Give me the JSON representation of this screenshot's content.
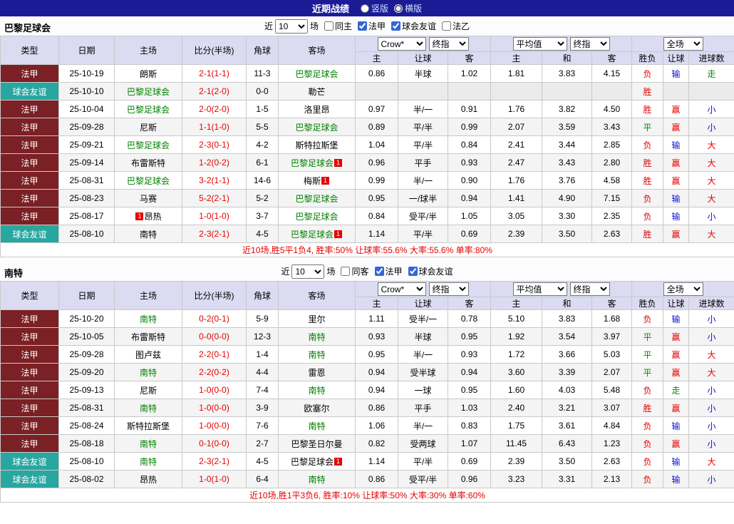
{
  "topbar": {
    "title": "近期战绩",
    "layout_options": [
      {
        "label": "竖版",
        "selected": false
      },
      {
        "label": "横版",
        "selected": true
      }
    ]
  },
  "colors": {
    "topbar_bg": "#1b1b96",
    "header_bg": "#dbdbf2",
    "ligue1_bg": "#7b2024",
    "friendly_bg": "#28a7a0",
    "focal_team": "#008000",
    "red": "#e60000",
    "green": "#009000",
    "blue": "#0f0fd0"
  },
  "table_header": {
    "static_cols": [
      "类型",
      "日期",
      "主场",
      "比分(半场)",
      "角球",
      "客场"
    ],
    "odds_group": {
      "select1": "Crow*",
      "select2": "终指",
      "cols": [
        "主",
        "让球",
        "客"
      ]
    },
    "avg_group": {
      "select1": "平均值",
      "select2": "终指",
      "cols": [
        "主",
        "和",
        "客"
      ]
    },
    "result_group": {
      "select": "全场",
      "cols": [
        "胜负",
        "让球",
        "进球数"
      ]
    }
  },
  "sections": [
    {
      "team": "巴黎足球会",
      "filter": {
        "prefix": "近",
        "count": "10",
        "suffix": "场",
        "checkboxes": [
          {
            "label": "同主",
            "checked": false
          },
          {
            "label": "法甲",
            "checked": true
          },
          {
            "label": "球会友谊",
            "checked": true
          },
          {
            "label": "法乙",
            "checked": false
          }
        ]
      },
      "rows": [
        {
          "type": "法甲",
          "type_class": "ligue1",
          "date": "25-10-19",
          "home": {
            "name": "朗斯"
          },
          "score": "2-1(1-1)",
          "corners": "11-3",
          "away": {
            "name": "巴黎足球会",
            "focal": true
          },
          "odds": [
            "0.86",
            "半球",
            "1.02"
          ],
          "avg": [
            "1.81",
            "3.83",
            "4.15"
          ],
          "results": [
            {
              "text": "负",
              "color": "red"
            },
            {
              "text": "输",
              "color": "blue"
            },
            {
              "text": "走",
              "color": "green"
            }
          ]
        },
        {
          "type": "球会友谊",
          "type_class": "friendly",
          "date": "25-10-10",
          "home": {
            "name": "巴黎足球会",
            "focal": true
          },
          "score": "2-1(2-0)",
          "corners": "0-0",
          "away": {
            "name": "勒芒"
          },
          "odds": [
            "",
            "",
            ""
          ],
          "avg": [
            "",
            "",
            ""
          ],
          "results": [
            {
              "text": "胜",
              "color": "red"
            },
            {
              "text": "",
              "color": ""
            },
            {
              "text": "",
              "color": ""
            }
          ]
        },
        {
          "type": "法甲",
          "type_class": "ligue1",
          "date": "25-10-04",
          "home": {
            "name": "巴黎足球会",
            "focal": true
          },
          "score": "2-0(2-0)",
          "corners": "1-5",
          "away": {
            "name": "洛里昂"
          },
          "odds": [
            "0.97",
            "半/一",
            "0.91"
          ],
          "avg": [
            "1.76",
            "3.82",
            "4.50"
          ],
          "results": [
            {
              "text": "胜",
              "color": "red"
            },
            {
              "text": "赢",
              "color": "red"
            },
            {
              "text": "小",
              "color": "blue"
            }
          ]
        },
        {
          "type": "法甲",
          "type_class": "ligue1",
          "date": "25-09-28",
          "home": {
            "name": "尼斯"
          },
          "score": "1-1(1-0)",
          "corners": "5-5",
          "away": {
            "name": "巴黎足球会",
            "focal": true
          },
          "odds": [
            "0.89",
            "平/半",
            "0.99"
          ],
          "avg": [
            "2.07",
            "3.59",
            "3.43"
          ],
          "results": [
            {
              "text": "平",
              "color": "green"
            },
            {
              "text": "赢",
              "color": "red"
            },
            {
              "text": "小",
              "color": "blue"
            }
          ]
        },
        {
          "type": "法甲",
          "type_class": "ligue1",
          "date": "25-09-21",
          "home": {
            "name": "巴黎足球会",
            "focal": true
          },
          "score": "2-3(0-1)",
          "corners": "4-2",
          "away": {
            "name": "斯特拉斯堡"
          },
          "odds": [
            "1.04",
            "平/半",
            "0.84"
          ],
          "avg": [
            "2.41",
            "3.44",
            "2.85"
          ],
          "results": [
            {
              "text": "负",
              "color": "red"
            },
            {
              "text": "输",
              "color": "blue"
            },
            {
              "text": "大",
              "color": "red"
            }
          ]
        },
        {
          "type": "法甲",
          "type_class": "ligue1",
          "date": "25-09-14",
          "home": {
            "name": "布雷斯特"
          },
          "score": "1-2(0-2)",
          "corners": "6-1",
          "away": {
            "name": "巴黎足球会",
            "focal": true,
            "badge": "1"
          },
          "odds": [
            "0.96",
            "平手",
            "0.93"
          ],
          "avg": [
            "2.47",
            "3.43",
            "2.80"
          ],
          "results": [
            {
              "text": "胜",
              "color": "red"
            },
            {
              "text": "赢",
              "color": "red"
            },
            {
              "text": "大",
              "color": "red"
            }
          ]
        },
        {
          "type": "法甲",
          "type_class": "ligue1",
          "date": "25-08-31",
          "home": {
            "name": "巴黎足球会",
            "focal": true
          },
          "score": "3-2(1-1)",
          "corners": "14-6",
          "away": {
            "name": "梅斯",
            "badge": "1"
          },
          "odds": [
            "0.99",
            "半/一",
            "0.90"
          ],
          "avg": [
            "1.76",
            "3.76",
            "4.58"
          ],
          "results": [
            {
              "text": "胜",
              "color": "red"
            },
            {
              "text": "赢",
              "color": "red"
            },
            {
              "text": "大",
              "color": "red"
            }
          ]
        },
        {
          "type": "法甲",
          "type_class": "ligue1",
          "date": "25-08-23",
          "home": {
            "name": "马赛"
          },
          "score": "5-2(2-1)",
          "corners": "5-2",
          "away": {
            "name": "巴黎足球会",
            "focal": true
          },
          "odds": [
            "0.95",
            "一/球半",
            "0.94"
          ],
          "avg": [
            "1.41",
            "4.90",
            "7.15"
          ],
          "results": [
            {
              "text": "负",
              "color": "red"
            },
            {
              "text": "输",
              "color": "blue"
            },
            {
              "text": "大",
              "color": "red"
            }
          ]
        },
        {
          "type": "法甲",
          "type_class": "ligue1",
          "date": "25-08-17",
          "home": {
            "name": "昂热",
            "badge": "1",
            "badge_side": "left"
          },
          "score": "1-0(1-0)",
          "corners": "3-7",
          "away": {
            "name": "巴黎足球会",
            "focal": true
          },
          "odds": [
            "0.84",
            "受平/半",
            "1.05"
          ],
          "avg": [
            "3.05",
            "3.30",
            "2.35"
          ],
          "results": [
            {
              "text": "负",
              "color": "red"
            },
            {
              "text": "输",
              "color": "blue"
            },
            {
              "text": "小",
              "color": "blue"
            }
          ]
        },
        {
          "type": "球会友谊",
          "type_class": "friendly",
          "date": "25-08-10",
          "home": {
            "name": "南特"
          },
          "score": "2-3(2-1)",
          "corners": "4-5",
          "away": {
            "name": "巴黎足球会",
            "focal": true,
            "badge": "1"
          },
          "odds": [
            "1.14",
            "平/半",
            "0.69"
          ],
          "avg": [
            "2.39",
            "3.50",
            "2.63"
          ],
          "results": [
            {
              "text": "胜",
              "color": "red"
            },
            {
              "text": "赢",
              "color": "red"
            },
            {
              "text": "大",
              "color": "red"
            }
          ]
        }
      ],
      "summary": "近10场,胜5平1负4, 胜率:50% 让球率:55.6% 大率:55.6% 单率:80%"
    },
    {
      "team": "南特",
      "filter": {
        "prefix": "近",
        "count": "10",
        "suffix": "场",
        "checkboxes": [
          {
            "label": "同客",
            "checked": false
          },
          {
            "label": "法甲",
            "checked": true
          },
          {
            "label": "球会友谊",
            "checked": true
          }
        ]
      },
      "rows": [
        {
          "type": "法甲",
          "type_class": "ligue1",
          "date": "25-10-20",
          "home": {
            "name": "南特",
            "focal": true
          },
          "score": "0-2(0-1)",
          "corners": "5-9",
          "away": {
            "name": "里尔"
          },
          "odds": [
            "1.11",
            "受半/一",
            "0.78"
          ],
          "avg": [
            "5.10",
            "3.83",
            "1.68"
          ],
          "results": [
            {
              "text": "负",
              "color": "red"
            },
            {
              "text": "输",
              "color": "blue"
            },
            {
              "text": "小",
              "color": "blue"
            }
          ]
        },
        {
          "type": "法甲",
          "type_class": "ligue1",
          "date": "25-10-05",
          "home": {
            "name": "布雷斯特"
          },
          "score": "0-0(0-0)",
          "corners": "12-3",
          "away": {
            "name": "南特",
            "focal": true
          },
          "odds": [
            "0.93",
            "半球",
            "0.95"
          ],
          "avg": [
            "1.92",
            "3.54",
            "3.97"
          ],
          "results": [
            {
              "text": "平",
              "color": "green"
            },
            {
              "text": "赢",
              "color": "red"
            },
            {
              "text": "小",
              "color": "blue"
            }
          ]
        },
        {
          "type": "法甲",
          "type_class": "ligue1",
          "date": "25-09-28",
          "home": {
            "name": "图卢兹"
          },
          "score": "2-2(0-1)",
          "corners": "1-4",
          "away": {
            "name": "南特",
            "focal": true
          },
          "odds": [
            "0.95",
            "半/一",
            "0.93"
          ],
          "avg": [
            "1.72",
            "3.66",
            "5.03"
          ],
          "results": [
            {
              "text": "平",
              "color": "green"
            },
            {
              "text": "赢",
              "color": "red"
            },
            {
              "text": "大",
              "color": "red"
            }
          ]
        },
        {
          "type": "法甲",
          "type_class": "ligue1",
          "date": "25-09-20",
          "home": {
            "name": "南特",
            "focal": true
          },
          "score": "2-2(0-2)",
          "corners": "4-4",
          "away": {
            "name": "雷恩"
          },
          "odds": [
            "0.94",
            "受半球",
            "0.94"
          ],
          "avg": [
            "3.60",
            "3.39",
            "2.07"
          ],
          "results": [
            {
              "text": "平",
              "color": "green"
            },
            {
              "text": "赢",
              "color": "red"
            },
            {
              "text": "大",
              "color": "red"
            }
          ]
        },
        {
          "type": "法甲",
          "type_class": "ligue1",
          "date": "25-09-13",
          "home": {
            "name": "尼斯"
          },
          "score": "1-0(0-0)",
          "corners": "7-4",
          "away": {
            "name": "南特",
            "focal": true
          },
          "odds": [
            "0.94",
            "一球",
            "0.95"
          ],
          "avg": [
            "1.60",
            "4.03",
            "5.48"
          ],
          "results": [
            {
              "text": "负",
              "color": "red"
            },
            {
              "text": "走",
              "color": "green"
            },
            {
              "text": "小",
              "color": "blue"
            }
          ]
        },
        {
          "type": "法甲",
          "type_class": "ligue1",
          "date": "25-08-31",
          "home": {
            "name": "南特",
            "focal": true
          },
          "score": "1-0(0-0)",
          "corners": "3-9",
          "away": {
            "name": "欧塞尔"
          },
          "odds": [
            "0.86",
            "平手",
            "1.03"
          ],
          "avg": [
            "2.40",
            "3.21",
            "3.07"
          ],
          "results": [
            {
              "text": "胜",
              "color": "red"
            },
            {
              "text": "赢",
              "color": "red"
            },
            {
              "text": "小",
              "color": "blue"
            }
          ]
        },
        {
          "type": "法甲",
          "type_class": "ligue1",
          "date": "25-08-24",
          "home": {
            "name": "斯特拉斯堡"
          },
          "score": "1-0(0-0)",
          "corners": "7-6",
          "away": {
            "name": "南特",
            "focal": true
          },
          "odds": [
            "1.06",
            "半/一",
            "0.83"
          ],
          "avg": [
            "1.75",
            "3.61",
            "4.84"
          ],
          "results": [
            {
              "text": "负",
              "color": "red"
            },
            {
              "text": "输",
              "color": "blue"
            },
            {
              "text": "小",
              "color": "blue"
            }
          ]
        },
        {
          "type": "法甲",
          "type_class": "ligue1",
          "date": "25-08-18",
          "home": {
            "name": "南特",
            "focal": true
          },
          "score": "0-1(0-0)",
          "corners": "2-7",
          "away": {
            "name": "巴黎圣日尔曼"
          },
          "odds": [
            "0.82",
            "受两球",
            "1.07"
          ],
          "avg": [
            "11.45",
            "6.43",
            "1.23"
          ],
          "results": [
            {
              "text": "负",
              "color": "red"
            },
            {
              "text": "赢",
              "color": "red"
            },
            {
              "text": "小",
              "color": "blue"
            }
          ]
        },
        {
          "type": "球会友谊",
          "type_class": "friendly",
          "date": "25-08-10",
          "home": {
            "name": "南特",
            "focal": true
          },
          "score": "2-3(2-1)",
          "corners": "4-5",
          "away": {
            "name": "巴黎足球会",
            "badge": "1"
          },
          "odds": [
            "1.14",
            "平/半",
            "0.69"
          ],
          "avg": [
            "2.39",
            "3.50",
            "2.63"
          ],
          "results": [
            {
              "text": "负",
              "color": "red"
            },
            {
              "text": "输",
              "color": "blue"
            },
            {
              "text": "大",
              "color": "red"
            }
          ]
        },
        {
          "type": "球会友谊",
          "type_class": "friendly",
          "date": "25-08-02",
          "home": {
            "name": "昂热"
          },
          "score": "1-0(1-0)",
          "corners": "6-4",
          "away": {
            "name": "南特",
            "focal": true
          },
          "odds": [
            "0.86",
            "受平/半",
            "0.96"
          ],
          "avg": [
            "3.23",
            "3.31",
            "2.13"
          ],
          "results": [
            {
              "text": "负",
              "color": "red"
            },
            {
              "text": "输",
              "color": "blue"
            },
            {
              "text": "小",
              "color": "blue"
            }
          ]
        }
      ],
      "summary": "近10场,胜1平3负6, 胜率:10% 让球率:50% 大率:30% 单率:60%"
    }
  ]
}
